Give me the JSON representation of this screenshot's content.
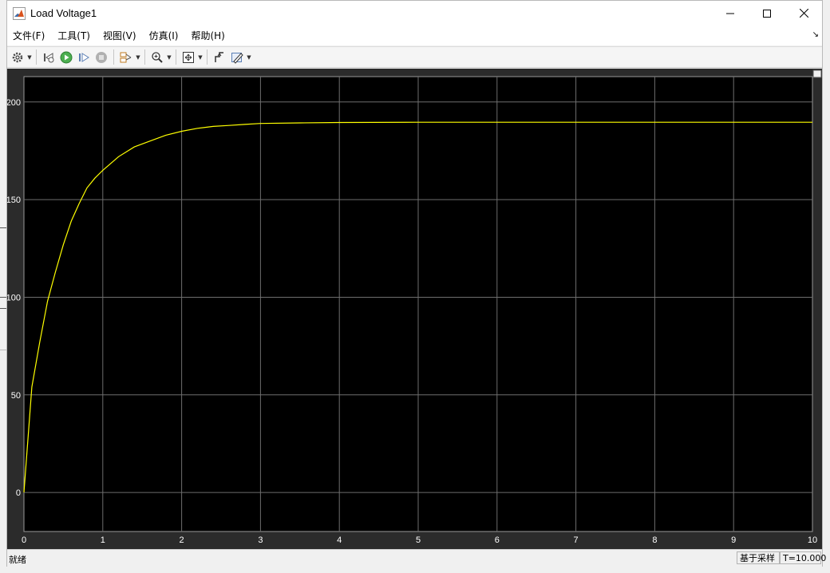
{
  "window": {
    "title": "Load Voltage1"
  },
  "menu": {
    "items": [
      "文件(F)",
      "工具(T)",
      "视图(V)",
      "仿真(I)",
      "帮助(H)"
    ]
  },
  "toolbar": {
    "icons": [
      "gear-icon",
      "step-back-icon",
      "run-icon",
      "step-forward-icon",
      "stop-icon",
      "signal-select-icon",
      "zoom-icon",
      "fit-to-view-icon",
      "triggers-icon",
      "edit-style-icon"
    ]
  },
  "status": {
    "left": "就绪",
    "mode": "基于采样",
    "time": "T=10.000"
  },
  "colors": {
    "plot_bg": "#000000",
    "grid": "#6e6e6e",
    "trace": "#ffff00",
    "tick_text": "#ffffff"
  },
  "chart_data": {
    "type": "line",
    "title": "",
    "xlabel": "",
    "ylabel": "",
    "xlim": [
      0,
      10
    ],
    "ylim": [
      -20,
      213
    ],
    "xticks": [
      0,
      1,
      2,
      3,
      4,
      5,
      6,
      7,
      8,
      9,
      10
    ],
    "yticks": [
      0,
      50,
      100,
      150,
      200
    ],
    "grid": true,
    "series": [
      {
        "x": [
          0,
          0.1,
          0.2,
          0.3,
          0.4,
          0.5,
          0.6,
          0.7,
          0.8,
          0.9,
          1.0,
          1.2,
          1.4,
          1.6,
          1.8,
          2.0,
          2.2,
          2.4,
          2.6,
          2.8,
          3.0,
          3.5,
          4,
          5,
          6,
          7,
          8,
          9,
          10
        ],
        "y": [
          0,
          54,
          77,
          98,
          113,
          127,
          139,
          148,
          156,
          161,
          165,
          172,
          177,
          180,
          183,
          185,
          186.5,
          187.5,
          188,
          188.5,
          189,
          189.3,
          189.5,
          189.6,
          189.6,
          189.6,
          189.6,
          189.6,
          189.6
        ]
      }
    ]
  }
}
